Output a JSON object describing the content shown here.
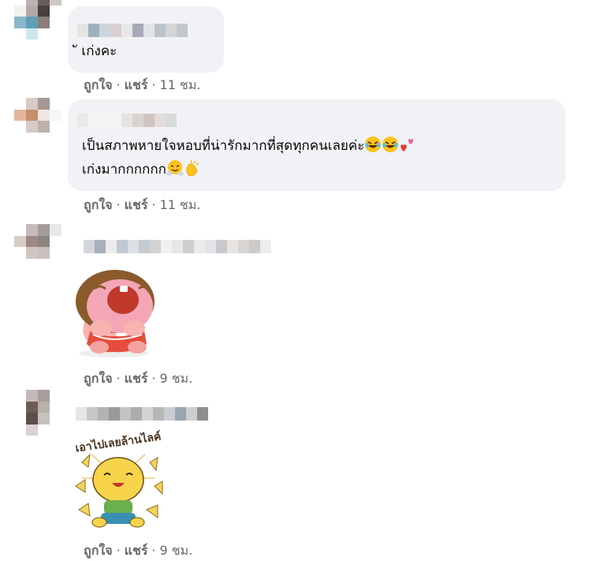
{
  "comments": [
    {
      "text": "ั เก่งคะ",
      "like_label": "ถูกใจ",
      "reply_label": "แชร์",
      "separator": "·",
      "time": "11 ชม."
    },
    {
      "text_line1": "เป็นสภาพหายใจหอบที่น่ารักมากที่สุดทุกคนเลยค่ะ",
      "text_line2": "เก่งมากกกกกก",
      "like_label": "ถูกใจ",
      "reply_label": "แชร์",
      "separator": "·",
      "time": "11 ชม."
    },
    {
      "like_label": "ถูกใจ",
      "reply_label": "แชร์",
      "separator": "·",
      "time": "9 ชม."
    },
    {
      "sticker_caption": "เอาไปเลยล้านไลค์",
      "like_label": "ถูกใจ",
      "reply_label": "แชร์",
      "separator": "·",
      "time": "9 ชม."
    }
  ],
  "icons": {
    "laughing": "face-with-tears-of-joy",
    "heart": "two-hearts",
    "huff": "face-with-steam",
    "clap": "clapping-hands"
  },
  "colors": {
    "bubble": "#f0f2f5",
    "meta_text": "#65676b",
    "text": "#050505"
  }
}
